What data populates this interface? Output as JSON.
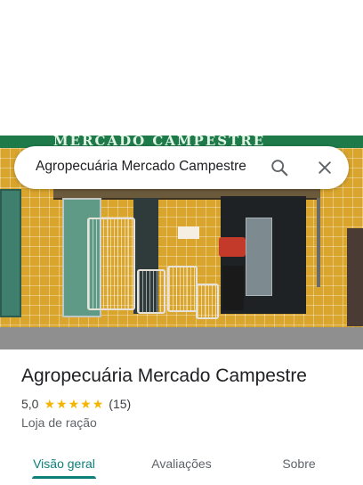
{
  "search": {
    "query": "Agropecuária Mercado Campestre"
  },
  "photo": {
    "sign_text": "MERCADO CAMPESTRE"
  },
  "place": {
    "name": "Agropecuária Mercado Campestre",
    "rating_value": "5,0",
    "stars": 5,
    "reviews_count": "(15)",
    "category": "Loja de ração"
  },
  "tabs": [
    {
      "label": "Visão geral",
      "active": true
    },
    {
      "label": "Avaliações",
      "active": false
    },
    {
      "label": "Sobre",
      "active": false
    }
  ],
  "colors": {
    "accent": "#0b7f7a",
    "star": "#f5b400",
    "text_primary": "#202124",
    "text_secondary": "#5f6368"
  },
  "icons": [
    "search-icon",
    "close-icon",
    "star-icon"
  ]
}
